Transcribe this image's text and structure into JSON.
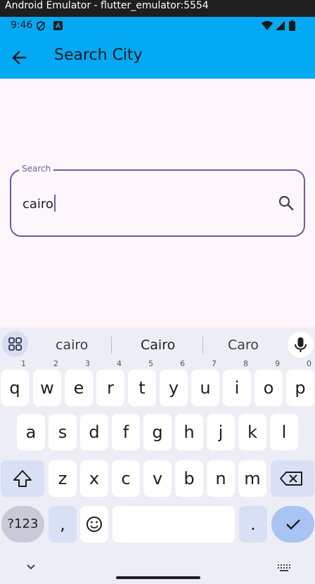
{
  "window": {
    "title": "Android Emulator - flutter_emulator:5554"
  },
  "status_bar": {
    "time": "9:46"
  },
  "app_bar": {
    "title": "Search City"
  },
  "search": {
    "label": "Search",
    "value": "cairo"
  },
  "keyboard": {
    "suggestions": [
      "cairo",
      "Cairo",
      "Caro"
    ],
    "row1": [
      {
        "key": "q",
        "num": "1"
      },
      {
        "key": "w",
        "num": "2"
      },
      {
        "key": "e",
        "num": "3"
      },
      {
        "key": "r",
        "num": "4"
      },
      {
        "key": "t",
        "num": "5"
      },
      {
        "key": "y",
        "num": "6"
      },
      {
        "key": "u",
        "num": "7"
      },
      {
        "key": "i",
        "num": "8"
      },
      {
        "key": "o",
        "num": "9"
      },
      {
        "key": "p",
        "num": "0"
      }
    ],
    "row2": [
      "a",
      "s",
      "d",
      "f",
      "g",
      "h",
      "j",
      "k",
      "l"
    ],
    "row3": [
      "z",
      "x",
      "c",
      "v",
      "b",
      "n",
      "m"
    ],
    "sym_label": "?123",
    "comma": ",",
    "period": "."
  }
}
